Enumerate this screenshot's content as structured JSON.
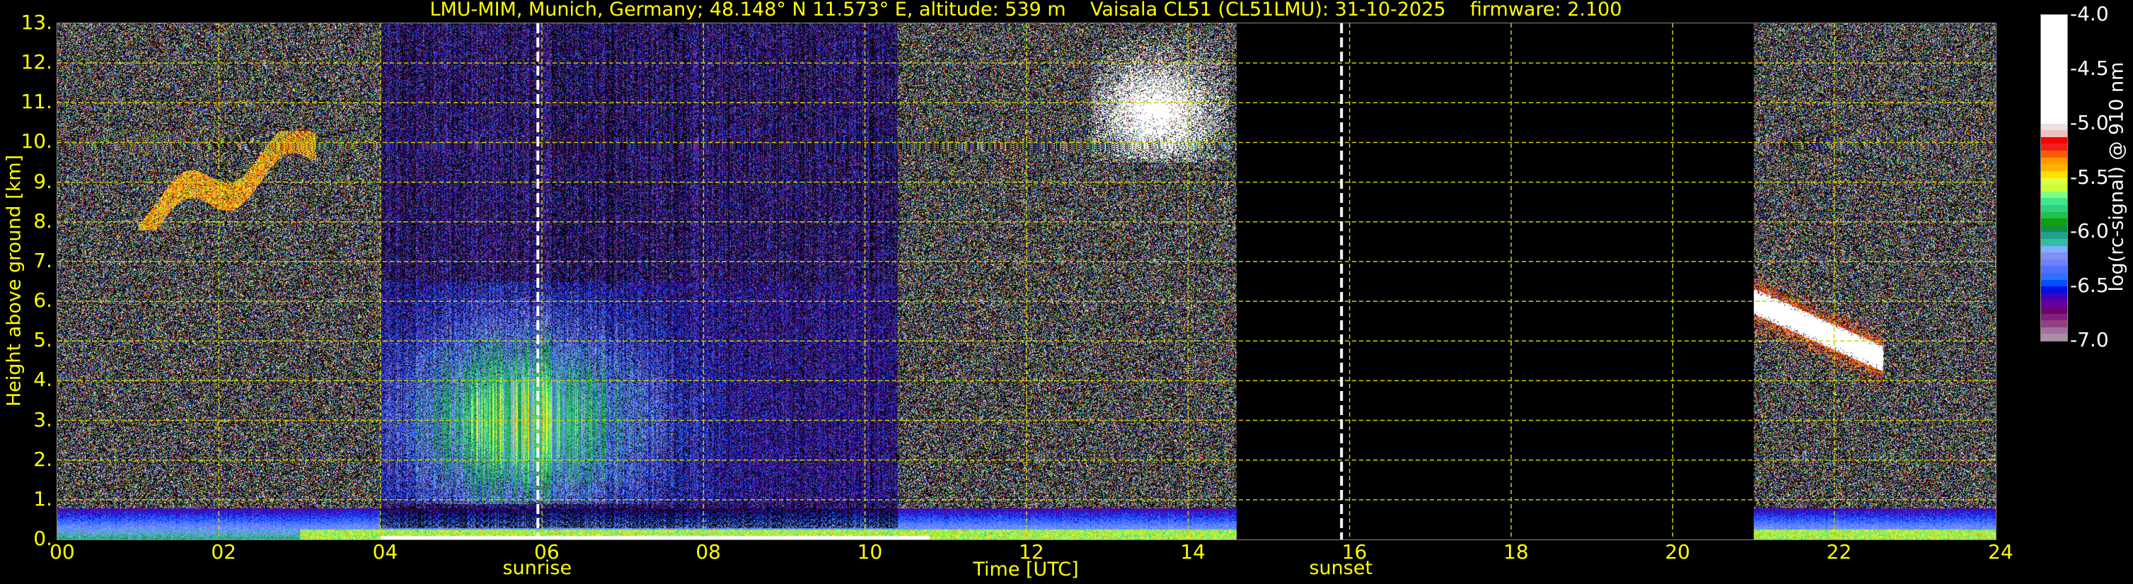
{
  "title": "LMU-MIM, Munich, Germany; 48.148° N 11.573° E, altitude: 539 m    Vaisala CL51 (CL51LMU): 31-10-2025    firmware: 2.100",
  "chart_data": {
    "type": "heatmap",
    "title": "LMU-MIM, Munich, Germany; 48.148° N 11.573° E, altitude: 539 m    Vaisala CL51 (CL51LMU): 31-10-2025    firmware: 2.100",
    "xlabel": "Time [UTC]",
    "ylabel": "Height above ground [km]",
    "xlim": [
      0,
      24
    ],
    "ylim": [
      0,
      13
    ],
    "x_ticks": [
      "00",
      "02",
      "04",
      "06",
      "08",
      "10",
      "12",
      "14",
      "16",
      "18",
      "20",
      "22",
      "24"
    ],
    "y_ticks": [
      "0.",
      "1.",
      "2.",
      "3.",
      "4.",
      "5.",
      "6.",
      "7.",
      "8.",
      "9.",
      "10.",
      "11.",
      "12.",
      "13."
    ],
    "grid": true,
    "events": [
      {
        "label": "sunrise",
        "time": 5.95
      },
      {
        "label": "sunset",
        "time": 15.9
      }
    ],
    "colorbar": {
      "label": "log(rc-signal) @ 910 nm",
      "range": [
        -7.0,
        -4.0
      ],
      "ticks": [
        "-4.0",
        "-4.5",
        "-5.0",
        "-5.5",
        "-6.0",
        "-6.5",
        "-7.0"
      ]
    },
    "regions": [
      {
        "name": "night-noise",
        "t": [
          0,
          4.0
        ],
        "boundary_layer_top_km": 0.7
      },
      {
        "name": "cirrus-cloud-early",
        "t": [
          1.0,
          3.2
        ],
        "h": [
          7.8,
          10.3
        ],
        "value": -5.4
      },
      {
        "name": "daytime-aerosol",
        "t": [
          4.0,
          10.4
        ],
        "h": [
          1.0,
          6.5
        ],
        "value": -6.0
      },
      {
        "name": "afternoon-noise",
        "t": [
          10.4,
          14.6
        ],
        "boundary_layer_top_km": 0.5
      },
      {
        "name": "high-cloud-noon",
        "t": [
          12.8,
          14.5
        ],
        "h": [
          9.5,
          12.8
        ],
        "value": -4.8
      },
      {
        "name": "no-data",
        "t": [
          14.6,
          21.0
        ]
      },
      {
        "name": "evening-cloud",
        "t": [
          21.0,
          22.6
        ],
        "h": [
          3.8,
          7.5
        ],
        "value": -4.5
      },
      {
        "name": "evening-noise",
        "t": [
          21.0,
          24.0
        ],
        "boundary_layer_top_km": 0.5
      }
    ]
  }
}
